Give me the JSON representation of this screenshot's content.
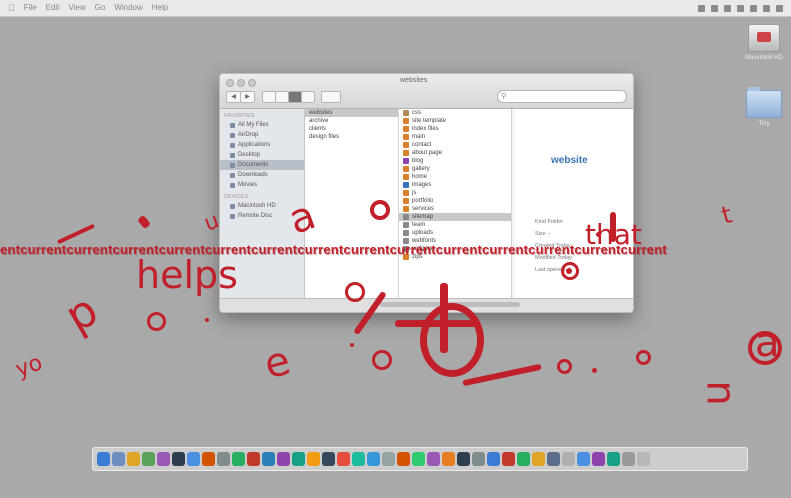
{
  "menubar": {
    "left_items": [
      "File",
      "Edit",
      "View",
      "Go",
      "Window",
      "Help"
    ],
    "right_items": [
      "status-a",
      "status-b",
      "status-c",
      "status-d",
      "status-e",
      "status-f",
      "status-g"
    ]
  },
  "desktop": {
    "icons": [
      {
        "label": "Macintosh HD",
        "icon": "hard-drive-icon"
      },
      {
        "label": "Tiny",
        "icon": "folder-icon"
      }
    ]
  },
  "finder": {
    "window_title": "websites",
    "toolbar": {
      "back": "◀",
      "forward": "▶",
      "view_modes": [
        "icon",
        "list",
        "column",
        "cover"
      ]
    },
    "search_placeholder": "",
    "sidebar": {
      "sections": [
        {
          "head": "FAVORITES",
          "items": [
            "All My Files",
            "AirDrop",
            "Applications",
            "Desktop",
            "Documents",
            "Downloads",
            "Movies"
          ]
        },
        {
          "head": "DEVICES",
          "items": [
            "Macintosh HD",
            "Remote Disc"
          ]
        }
      ],
      "selected": "Documents"
    },
    "column1": [
      "websites",
      "archive",
      "clients",
      "design files"
    ],
    "column1_selected": "websites",
    "column2": [
      "css",
      "site template",
      "index files",
      "main",
      "contact",
      "about page",
      "blog",
      "gallery",
      "home",
      "images",
      "js",
      "portfolio",
      "services",
      "sitemap",
      "team",
      "uploads",
      "webfonts",
      "widgets",
      "zips"
    ],
    "column2_selected": "sitemap",
    "preview": {
      "name": "website",
      "info": [
        "Kind Folder",
        "Size --",
        "Created Today",
        "Modified Today",
        "Last opened --"
      ]
    }
  },
  "overlay": {
    "banner": "entcurrentcurrentcurrentcurrentcurrentcurrentcurrentcurrentcurrentcurrentcurrentcurrentcurrentcurrent",
    "words": [
      "helps",
      "that",
      "a",
      "p",
      "e",
      "u",
      "a",
      "n",
      "o",
      "t",
      "yo"
    ]
  },
  "dock": {
    "colors": [
      "#3a7bd5",
      "#6c8fbf",
      "#e0a526",
      "#5aa15a",
      "#9b59b6",
      "#2c3e50",
      "#4a90e2",
      "#d35400",
      "#7f8c8d",
      "#27ae60",
      "#c0392b",
      "#2980b9",
      "#8e44ad",
      "#16a085",
      "#f39c12",
      "#34495e",
      "#e74c3c",
      "#1abc9c",
      "#3498db",
      "#95a5a6",
      "#d35400",
      "#2ecc71",
      "#9b59b6",
      "#e67e22",
      "#2c3e50",
      "#7f8c8d",
      "#3a7bd5",
      "#c0392b",
      "#27ae60",
      "#e0a526",
      "#5b6d8a",
      "#b0b0b0",
      "#4a90e2",
      "#8e44ad",
      "#16a085",
      "#999999",
      "#b8b8b8"
    ]
  }
}
